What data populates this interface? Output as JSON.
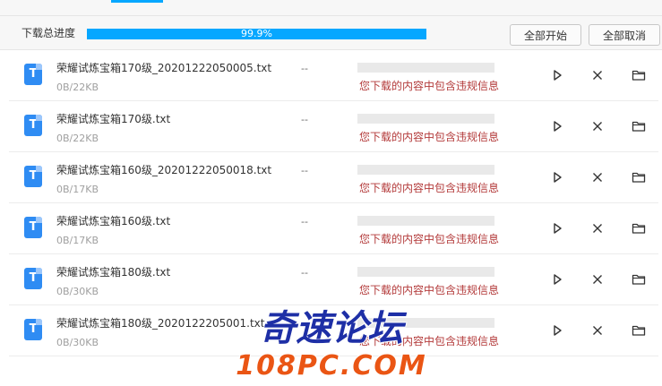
{
  "header": {
    "progress_label": "下载总进度",
    "progress_percent": 99.9,
    "progress_text": "99.9%",
    "start_all": "全部开始",
    "cancel_all": "全部取消"
  },
  "files": [
    {
      "icon_letter": "T",
      "name": "荣耀试炼宝箱170级_20201222050005.txt",
      "size": "0B/22KB",
      "speed": "--",
      "error": "您下载的内容中包含违规信息"
    },
    {
      "icon_letter": "T",
      "name": "荣耀试炼宝箱170级.txt",
      "size": "0B/22KB",
      "speed": "--",
      "error": "您下载的内容中包含违规信息"
    },
    {
      "icon_letter": "T",
      "name": "荣耀试炼宝箱160级_20201222050018.txt",
      "size": "0B/17KB",
      "speed": "--",
      "error": "您下载的内容中包含违规信息"
    },
    {
      "icon_letter": "T",
      "name": "荣耀试炼宝箱160级.txt",
      "size": "0B/17KB",
      "speed": "--",
      "error": "您下载的内容中包含违规信息"
    },
    {
      "icon_letter": "T",
      "name": "荣耀试炼宝箱180级.txt",
      "size": "0B/30KB",
      "speed": "--",
      "error": "您下载的内容中包含违规信息"
    },
    {
      "icon_letter": "T",
      "name": "荣耀试炼宝箱180级_2020122205001.txt",
      "size": "0B/30KB",
      "speed": "--",
      "error": "您下载的内容中包含违规信息"
    }
  ],
  "icons": {
    "file": "txt-file-icon",
    "play": "play-icon",
    "close": "close-icon",
    "folder": "folder-icon"
  },
  "colors": {
    "accent": "#06a7ff",
    "error": "#b33a3a",
    "file_icon": "#2f8cf3"
  },
  "watermark": {
    "line1": "奇速论坛",
    "line2": "108PC.COM"
  }
}
